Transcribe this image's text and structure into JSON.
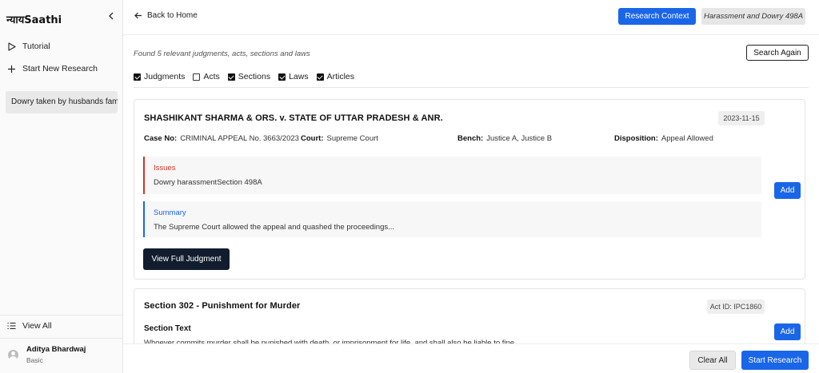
{
  "sidebar": {
    "brand": "न्यायSaathi",
    "collapse_icon": "chevron-left-icon",
    "tutorial": "Tutorial",
    "new_research": "Start New Research",
    "chat": "Dowry taken by husbands family",
    "view_all": "View All",
    "user_name": "Aditya Bhardwaj",
    "user_plan": "Basic"
  },
  "topbar": {
    "back": "Back to Home",
    "research_context": "Research Context",
    "context_chip": "Harassment and Dowry 498A"
  },
  "main": {
    "found_text": "Found 5 relevant judgments, acts, sections and laws",
    "search_again": "Search Again",
    "filters": [
      {
        "label": "Judgments",
        "checked": true
      },
      {
        "label": "Acts",
        "checked": false
      },
      {
        "label": "Sections",
        "checked": true
      },
      {
        "label": "Laws",
        "checked": true
      },
      {
        "label": "Articles",
        "checked": true
      }
    ]
  },
  "judgment": {
    "title": "SHASHIKANT SHARMA & ORS. v. STATE OF UTTAR PRADESH & ANR.",
    "date": "2023-11-15",
    "case_no_label": "Case No:",
    "case_no": "CRIMINAL APPEAL No. 3663/2023",
    "court_label": "Court:",
    "court": "Supreme Court",
    "bench_label": "Bench:",
    "bench": "Justice A, Justice B",
    "disposition_label": "Disposition:",
    "disposition": "Appeal Allowed",
    "issues_head": "Issues",
    "issues_text": "Dowry harassmentSection 498A",
    "summary_head": "Summary",
    "summary_text": "The Supreme Court allowed the appeal and quashed the proceedings...",
    "add": "Add",
    "view_full": "View Full Judgment"
  },
  "section": {
    "title": "Section 302 - Punishment for Murder",
    "act_id": "Act ID: IPC1860",
    "label": "Section Text",
    "text": "Whoever commits murder shall be punished with death, or imprisonment for life, and shall also be liable to fine.",
    "add": "Add"
  },
  "bottom": {
    "clear_all": "Clear All",
    "start_research": "Start Research"
  },
  "colors": {
    "primary": "#1a66e8",
    "issues": "#c8322a",
    "dark_button": "#111d2e"
  }
}
